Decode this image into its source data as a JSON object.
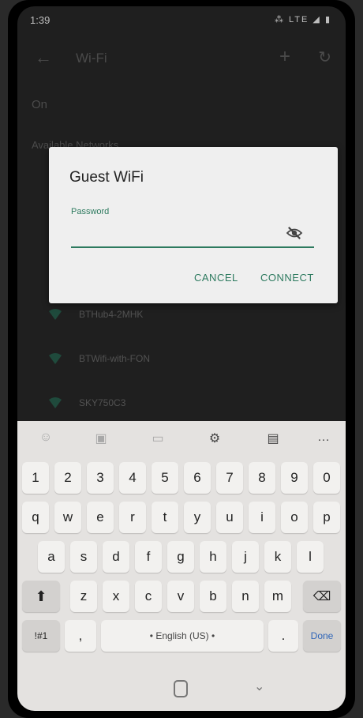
{
  "status_bar": {
    "time": "1:39",
    "icons": "⁂ LTE ◢ ▮"
  },
  "app_bar": {
    "title": "Wi-Fi"
  },
  "wifi_state": "On",
  "section_label": "Available Networks",
  "networks": [
    "BTHub4-2MHK",
    "BTWifi-with-FON",
    "SKY750C3"
  ],
  "dialog": {
    "title": "Guest WiFi",
    "password_label": "Password",
    "password_value": "",
    "cancel_label": "CANCEL",
    "connect_label": "CONNECT"
  },
  "keyboard": {
    "toolbar_icons": [
      "emoji-icon",
      "sticker-icon",
      "gif-icon",
      "settings-icon",
      "clipboard-icon",
      "more-icon"
    ],
    "row_numbers": [
      "1",
      "2",
      "3",
      "4",
      "5",
      "6",
      "7",
      "8",
      "9",
      "0"
    ],
    "row1": [
      "q",
      "w",
      "e",
      "r",
      "t",
      "y",
      "u",
      "i",
      "o",
      "p"
    ],
    "row2": [
      "a",
      "s",
      "d",
      "f",
      "g",
      "h",
      "j",
      "k",
      "l"
    ],
    "row3": [
      "z",
      "x",
      "c",
      "v",
      "b",
      "n",
      "m"
    ],
    "symbols_label": "!#1",
    "comma": ",",
    "space_label": "• English (US) •",
    "period": ".",
    "done_label": "Done"
  }
}
